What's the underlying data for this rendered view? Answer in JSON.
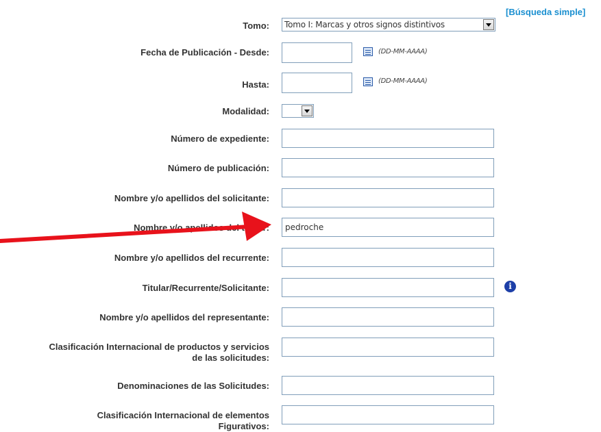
{
  "header": {
    "simple_search_link": "[Búsqueda simple]"
  },
  "form": {
    "tomo": {
      "label": "Tomo:",
      "selected": "Tomo I: Marcas y otros signos distintivos"
    },
    "fecha_desde": {
      "label": "Fecha de Publicación - Desde:",
      "hint": "(DD-MM-AAAA)",
      "value": ""
    },
    "fecha_hasta": {
      "label": "Hasta:",
      "hint": "(DD-MM-AAAA)",
      "value": ""
    },
    "modalidad": {
      "label": "Modalidad:",
      "selected": ""
    },
    "numero_expediente": {
      "label": "Número de expediente:",
      "value": ""
    },
    "numero_publicacion": {
      "label": "Número de publicación:",
      "value": ""
    },
    "solicitante": {
      "label": "Nombre y/o apellidos del solicitante:",
      "value": ""
    },
    "titular": {
      "label": "Nombre y/o apellidos del titular:",
      "value": "pedroche"
    },
    "recurrente": {
      "label": "Nombre y/o apellidos del recurrente:",
      "value": ""
    },
    "titular_recurrente_solicitante": {
      "label": "Titular/Recurrente/Solicitante:",
      "value": ""
    },
    "representante": {
      "label": "Nombre y/o apellidos del representante:",
      "value": ""
    },
    "clasificacion_productos": {
      "label_line1": "Clasificación Internacional de productos y servicios",
      "label_line2": "de las solicitudes:",
      "value": ""
    },
    "denominaciones": {
      "label": "Denominaciones de las Solicitudes:",
      "value": ""
    },
    "clasificacion_figurativos": {
      "label_line1": "Clasificación Internacional de elementos",
      "label_line2": "Figurativos:",
      "value": ""
    }
  },
  "icons": {
    "calendar": "calendar-icon",
    "info": "info-icon",
    "annotation": "red-arrow-annotation"
  },
  "colors": {
    "link": "#1a8fd0",
    "arrow": "#e8121b",
    "info": "#1d3fa8"
  }
}
